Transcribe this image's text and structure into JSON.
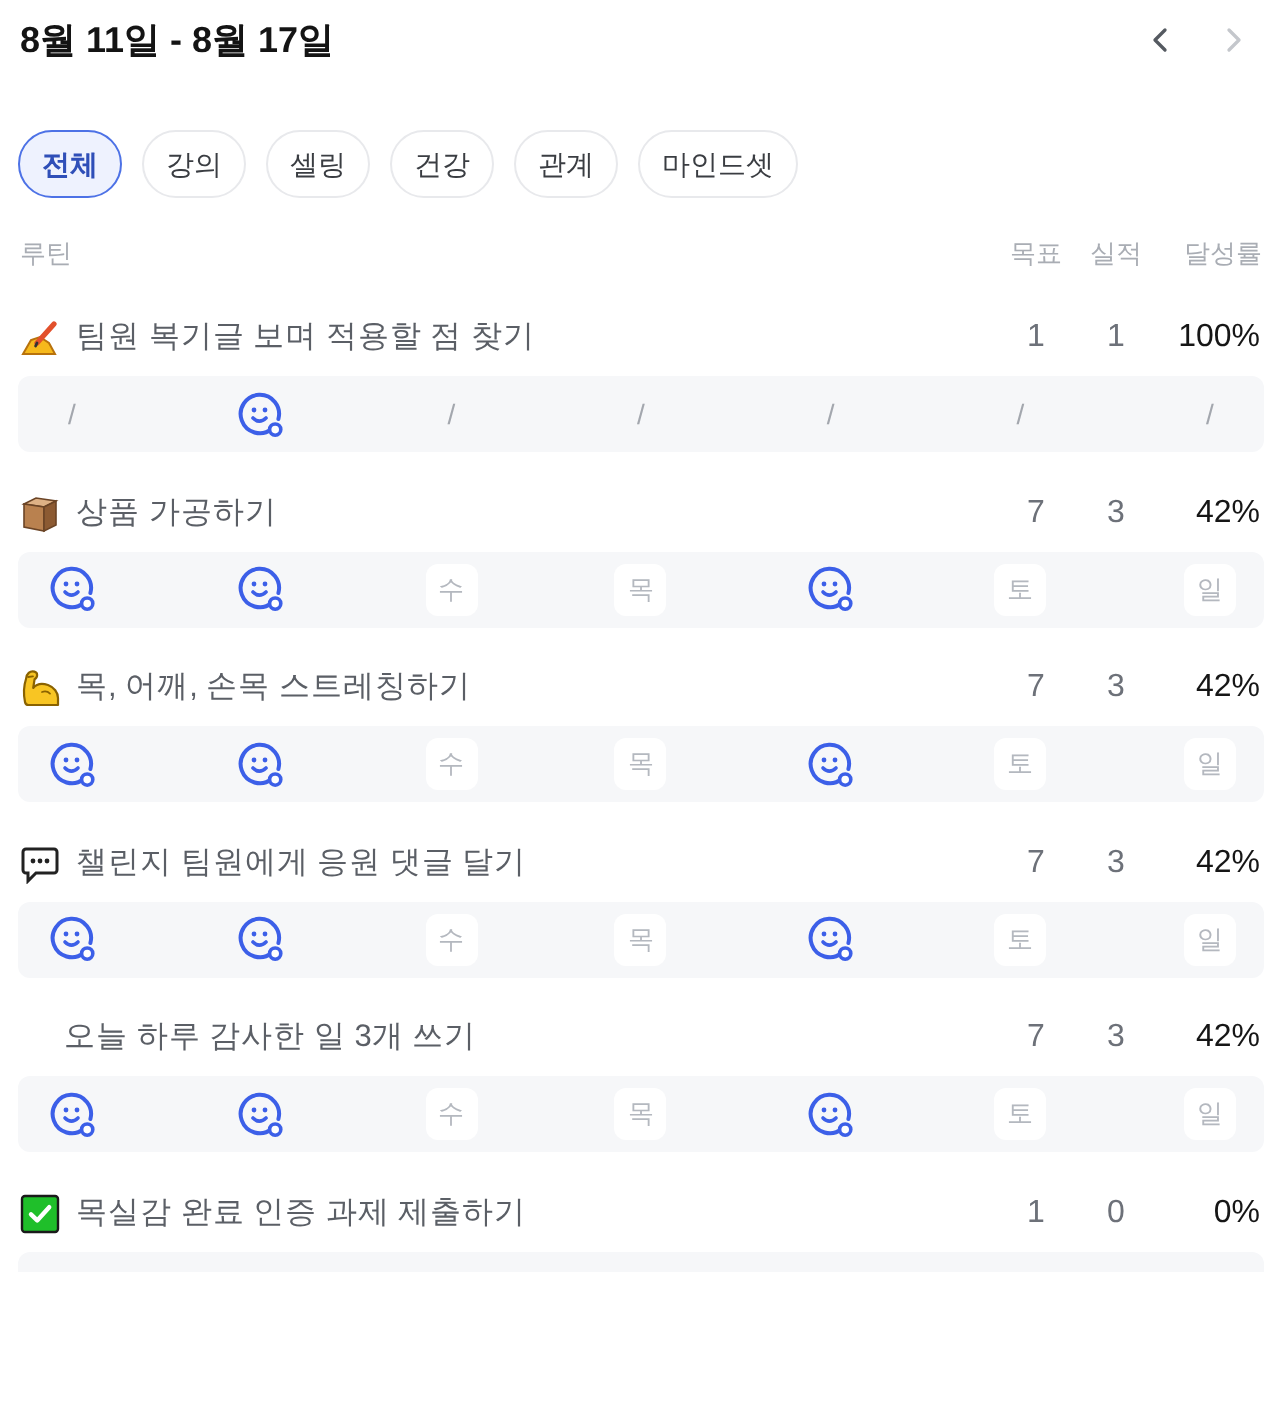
{
  "header": {
    "title": "8월 11일 - 8월 17일",
    "nav": [
      {
        "kind": "prev",
        "disabled": false
      },
      {
        "kind": "next",
        "disabled": true
      }
    ]
  },
  "tabs": [
    {
      "label": "전체",
      "selected": true
    },
    {
      "label": "강의",
      "selected": false
    },
    {
      "label": "셀링",
      "selected": false
    },
    {
      "label": "건강",
      "selected": false
    },
    {
      "label": "관계",
      "selected": false
    },
    {
      "label": "마인드셋",
      "selected": false
    }
  ],
  "table": {
    "columns": [
      "루틴",
      "목표",
      "실적",
      "달성률"
    ],
    "routines": [
      {
        "kind": "writing",
        "title": "팀원 복기글 보며 적용할 점 찾기",
        "goal": "1",
        "actual": "1",
        "rate": "100%",
        "days": [
          {
            "kind": "skip",
            "label": "/"
          },
          {
            "kind": "done"
          },
          {
            "kind": "skip",
            "label": "/"
          },
          {
            "kind": "skip",
            "label": "/"
          },
          {
            "kind": "skip",
            "label": "/"
          },
          {
            "kind": "skip",
            "label": "/"
          },
          {
            "kind": "skip",
            "label": "/"
          }
        ]
      },
      {
        "kind": "package",
        "title": "상품 가공하기",
        "goal": "7",
        "actual": "3",
        "rate": "42%",
        "days": [
          {
            "kind": "done"
          },
          {
            "kind": "done"
          },
          {
            "kind": "day",
            "label": "수"
          },
          {
            "kind": "day",
            "label": "목"
          },
          {
            "kind": "done"
          },
          {
            "kind": "day",
            "label": "토"
          },
          {
            "kind": "day",
            "label": "일"
          }
        ]
      },
      {
        "kind": "arm",
        "title": "목, 어깨, 손목 스트레칭하기",
        "goal": "7",
        "actual": "3",
        "rate": "42%",
        "days": [
          {
            "kind": "done"
          },
          {
            "kind": "done"
          },
          {
            "kind": "day",
            "label": "수"
          },
          {
            "kind": "day",
            "label": "목"
          },
          {
            "kind": "done"
          },
          {
            "kind": "day",
            "label": "토"
          },
          {
            "kind": "day",
            "label": "일"
          }
        ]
      },
      {
        "kind": "chat",
        "title": "챌린지 팀원에게 응원 댓글 달기",
        "goal": "7",
        "actual": "3",
        "rate": "42%",
        "days": [
          {
            "kind": "done"
          },
          {
            "kind": "done"
          },
          {
            "kind": "day",
            "label": "수"
          },
          {
            "kind": "day",
            "label": "목"
          },
          {
            "kind": "done"
          },
          {
            "kind": "day",
            "label": "토"
          },
          {
            "kind": "day",
            "label": "일"
          }
        ]
      },
      {
        "kind": "plain",
        "title": "오늘 하루 감사한 일 3개 쓰기",
        "goal": "7",
        "actual": "3",
        "rate": "42%",
        "days": [
          {
            "kind": "done"
          },
          {
            "kind": "done"
          },
          {
            "kind": "day",
            "label": "수"
          },
          {
            "kind": "day",
            "label": "목"
          },
          {
            "kind": "done"
          },
          {
            "kind": "day",
            "label": "토"
          },
          {
            "kind": "day",
            "label": "일"
          }
        ]
      },
      {
        "kind": "check",
        "title": "목실감 완료 인증 과제 제출하기",
        "goal": "1",
        "actual": "0",
        "rate": "0%"
      }
    ]
  }
}
